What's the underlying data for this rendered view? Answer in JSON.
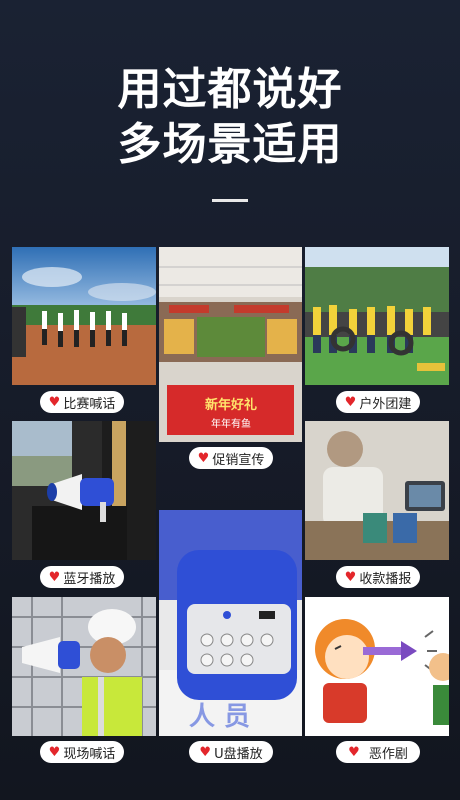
{
  "headline": {
    "line1": "用过都说好",
    "line2": "多场景适用"
  },
  "scenes": {
    "competition": {
      "label": "比赛喊话",
      "icon": "heart-icon"
    },
    "promotion": {
      "label": "促销宣传",
      "icon": "heart-icon",
      "sign_main": "新年好礼",
      "sign_sub": "年年有鱼"
    },
    "outdoor": {
      "label": "户外团建",
      "icon": "heart-icon"
    },
    "bluetooth": {
      "label": "蓝牙播放",
      "icon": "heart-icon"
    },
    "payment": {
      "label": "收款播报",
      "icon": "heart-icon"
    },
    "onsite": {
      "label": "现场喊话",
      "icon": "heart-icon"
    },
    "usb": {
      "label": "U盘播放",
      "icon": "heart-icon"
    },
    "prank": {
      "label": "恶作剧",
      "icon": "heart-icon"
    }
  },
  "colors": {
    "accent_red": "#e3262b",
    "megaphone_blue": "#2f4fd6"
  }
}
